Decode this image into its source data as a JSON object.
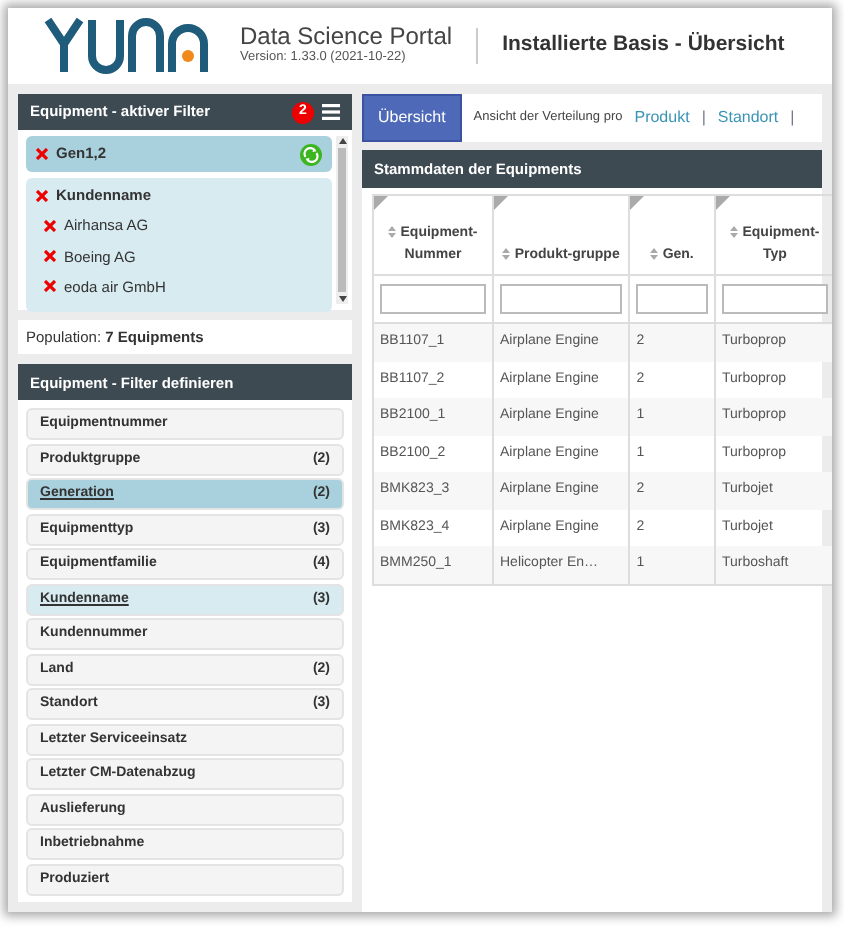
{
  "header": {
    "app_title": "Data Science Portal",
    "version": "Version: 1.33.0 (2021-10-22)",
    "page_title": "Installierte Basis - Übersicht"
  },
  "active_filter": {
    "title": "Equipment - aktiver Filter",
    "badge": "2",
    "groups": [
      {
        "kind": "value",
        "label": "Gen1,2"
      },
      {
        "kind": "list",
        "label": "Kundenname",
        "values": [
          "Airhansa AG",
          "Boeing AG",
          "eoda air GmbH"
        ]
      }
    ]
  },
  "population": {
    "label": "Population:",
    "value": "7 Equipments"
  },
  "filter_define": {
    "title": "Equipment - Filter definieren",
    "items": [
      {
        "label": "Equipmentnummer",
        "active": false,
        "selected": false
      },
      {
        "label": "Produktgruppe",
        "count": "(2)",
        "active": false,
        "selected": false
      },
      {
        "label": "Generation",
        "count": "(2)",
        "active": true,
        "selected": true
      },
      {
        "label": "Equipmenttyp",
        "count": "(3)",
        "active": false,
        "selected": false
      },
      {
        "label": "Equipmentfamilie",
        "count": "(4)",
        "active": false,
        "selected": false
      },
      {
        "label": "Kundenname",
        "count": "(3)",
        "active": true,
        "selected": false
      },
      {
        "label": "Kundennummer",
        "active": false,
        "selected": false
      },
      {
        "label": "Land",
        "count": "(2)",
        "active": false,
        "selected": false
      },
      {
        "label": "Standort",
        "count": "(3)",
        "active": false,
        "selected": false
      },
      {
        "label": "Letzter Serviceeinsatz",
        "active": false,
        "selected": false
      },
      {
        "label": "Letzter CM-Datenabzug",
        "active": false,
        "selected": false
      },
      {
        "label": "Auslieferung",
        "active": false,
        "selected": false
      },
      {
        "label": "Inbetriebnahme",
        "active": false,
        "selected": false
      },
      {
        "label": "Produziert",
        "active": false,
        "selected": false
      }
    ]
  },
  "view_bar": {
    "tabs": [
      {
        "label": "Übersicht",
        "selected": true
      }
    ],
    "prefix": "Ansicht der Verteilung pro",
    "items": [
      {
        "kind": "link",
        "label": "Produkt"
      },
      {
        "kind": "separator",
        "label": "|"
      },
      {
        "kind": "link",
        "label": "Standort"
      },
      {
        "kind": "separator",
        "label": "|"
      }
    ]
  },
  "table": {
    "title": "Stammdaten der Equipments",
    "columns": [
      "Equipment-Nummer",
      "Produkt-gruppe",
      "Gen.",
      "Equipment-Typ"
    ],
    "rows": [
      [
        "BB1107_1",
        "Airplane Engine",
        "2",
        "Turboprop"
      ],
      [
        "BB1107_2",
        "Airplane Engine",
        "2",
        "Turboprop"
      ],
      [
        "BB2100_1",
        "Airplane Engine",
        "1",
        "Turboprop"
      ],
      [
        "BB2100_2",
        "Airplane Engine",
        "1",
        "Turboprop"
      ],
      [
        "BMK823_3",
        "Airplane Engine",
        "2",
        "Turbojet"
      ],
      [
        "BMK823_4",
        "Airplane Engine",
        "2",
        "Turbojet"
      ],
      [
        "BMM250_1",
        "Helicopter En…",
        "1",
        "Turboshaft"
      ]
    ]
  }
}
